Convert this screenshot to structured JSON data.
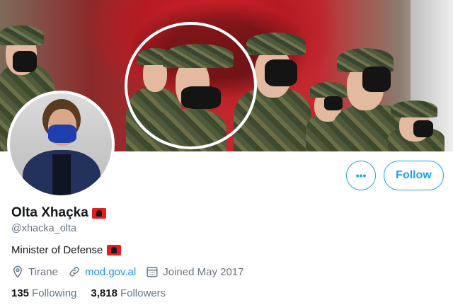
{
  "profile": {
    "name": "Olta Xhaçka",
    "handle": "@xhacka_olta",
    "bio": "Minister of Defense",
    "location": "Tirane",
    "website": "mod.gov.al",
    "joined": "Joined May 2017",
    "following_count": "135",
    "following_label": "Following",
    "followers_count": "3,818",
    "followers_label": "Followers"
  },
  "actions": {
    "more_label": "•••",
    "follow_label": "Follow"
  },
  "icons": {
    "location": "location-pin-icon",
    "link": "link-icon",
    "calendar": "calendar-icon",
    "more": "more-icon",
    "flag": "albania-flag-icon"
  },
  "colors": {
    "accent": "#1da1f2",
    "link": "#1b95e0",
    "muted": "#657786",
    "text": "#14171a",
    "flag_red": "#e41e20"
  }
}
